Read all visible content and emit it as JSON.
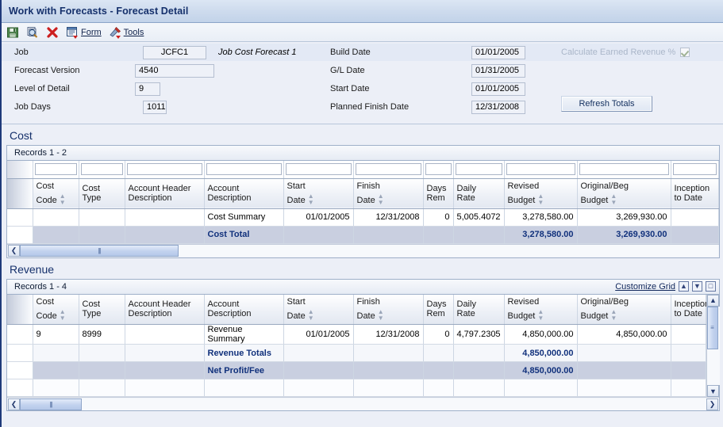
{
  "window": {
    "title": "Work with Forecasts - Forecast Detail"
  },
  "toolbar": {
    "items": [
      {
        "icon": "save-icon",
        "label": ""
      },
      {
        "icon": "find-icon",
        "label": ""
      },
      {
        "icon": "delete-icon",
        "label": ""
      },
      {
        "icon": "form-icon",
        "label": "Form"
      },
      {
        "icon": "tools-icon",
        "label": "Tools"
      }
    ],
    "form_label": "Form",
    "tools_label": "Tools"
  },
  "header": {
    "left": [
      {
        "label": "Job",
        "value": "JCFC1",
        "desc": "Job Cost Forecast 1"
      },
      {
        "label": "Forecast Version",
        "value": "4540",
        "desc": ""
      },
      {
        "label": "Level of Detail",
        "value": "9",
        "desc": ""
      },
      {
        "label": "Job Days",
        "value": "1011",
        "desc": ""
      }
    ],
    "right": [
      {
        "label": "Build Date",
        "value": "01/01/2005"
      },
      {
        "label": "G/L Date",
        "value": "01/31/2005"
      },
      {
        "label": "Start Date",
        "value": "01/01/2005"
      },
      {
        "label": "Planned Finish Date",
        "value": "12/31/2008"
      }
    ],
    "calc_earned_revenue_label": "Calculate Earned Revenue %",
    "calc_earned_revenue_checked": true,
    "refresh_totals_label": "Refresh Totals"
  },
  "cost": {
    "section_title": "Cost",
    "records_label": "Records 1 - 2",
    "columns": [
      {
        "label": "Cost\nCode",
        "sortable": true
      },
      {
        "label": "Cost\nType",
        "sortable": false
      },
      {
        "label": "Account Header\nDescription",
        "sortable": false
      },
      {
        "label": "Account\nDescription",
        "sortable": false
      },
      {
        "label": "Start\nDate",
        "sortable": true
      },
      {
        "label": "Finish\nDate",
        "sortable": true
      },
      {
        "label": "Days\nRem",
        "sortable": false
      },
      {
        "label": "Daily\nRate",
        "sortable": false
      },
      {
        "label": "Revised\nBudget",
        "sortable": true
      },
      {
        "label": "Original/Beg\nBudget",
        "sortable": true
      },
      {
        "label": "Inception\nto Date",
        "sortable": false
      }
    ],
    "rows": [
      {
        "kind": "data",
        "cells": [
          "",
          "",
          "",
          "Cost Summary",
          "01/01/2005",
          "12/31/2008",
          "0",
          "5,005.4072",
          "3,278,580.00",
          "3,269,930.00",
          ""
        ]
      },
      {
        "kind": "total",
        "cells": [
          "",
          "",
          "",
          "Cost Total",
          "",
          "",
          "",
          "",
          "3,278,580.00",
          "3,269,930.00",
          ""
        ]
      }
    ]
  },
  "revenue": {
    "section_title": "Revenue",
    "records_label": "Records 1 - 4",
    "customize_grid_label": "Customize Grid",
    "grid_icons": [
      "export-up-icon",
      "import-down-icon",
      "maximize-icon"
    ],
    "columns": [
      {
        "label": "Cost\nCode",
        "sortable": true
      },
      {
        "label": "Cost\nType",
        "sortable": false
      },
      {
        "label": "Account Header\nDescription",
        "sortable": false
      },
      {
        "label": "Account\nDescription",
        "sortable": false
      },
      {
        "label": "Start\nDate",
        "sortable": true
      },
      {
        "label": "Finish\nDate",
        "sortable": true
      },
      {
        "label": "Days\nRem",
        "sortable": false
      },
      {
        "label": "Daily\nRate",
        "sortable": false
      },
      {
        "label": "Revised\nBudget",
        "sortable": true
      },
      {
        "label": "Original/Beg\nBudget",
        "sortable": true
      },
      {
        "label": "Inception\nto Date",
        "sortable": false
      }
    ],
    "rows": [
      {
        "kind": "data",
        "cells": [
          "9",
          "8999",
          "",
          "Revenue Summary",
          "01/01/2005",
          "12/31/2008",
          "0",
          "4,797.2305",
          "4,850,000.00",
          "4,850,000.00",
          ""
        ]
      },
      {
        "kind": "total2",
        "cells": [
          "",
          "",
          "",
          "Revenue Totals",
          "",
          "",
          "",
          "",
          "4,850,000.00",
          "",
          ""
        ]
      },
      {
        "kind": "total",
        "cells": [
          "",
          "",
          "",
          "Net Profit/Fee",
          "",
          "",
          "",
          "",
          "4,850,000.00",
          "",
          ""
        ]
      },
      {
        "kind": "blank",
        "cells": [
          "",
          "",
          "",
          "",
          "",
          "",
          "",
          "",
          "",
          "",
          ""
        ]
      }
    ]
  },
  "colors": {
    "accent": "#15306b",
    "total_text": "#11317c",
    "panel_bg": "#eceff7",
    "grid_border": "#9fb0c9"
  }
}
